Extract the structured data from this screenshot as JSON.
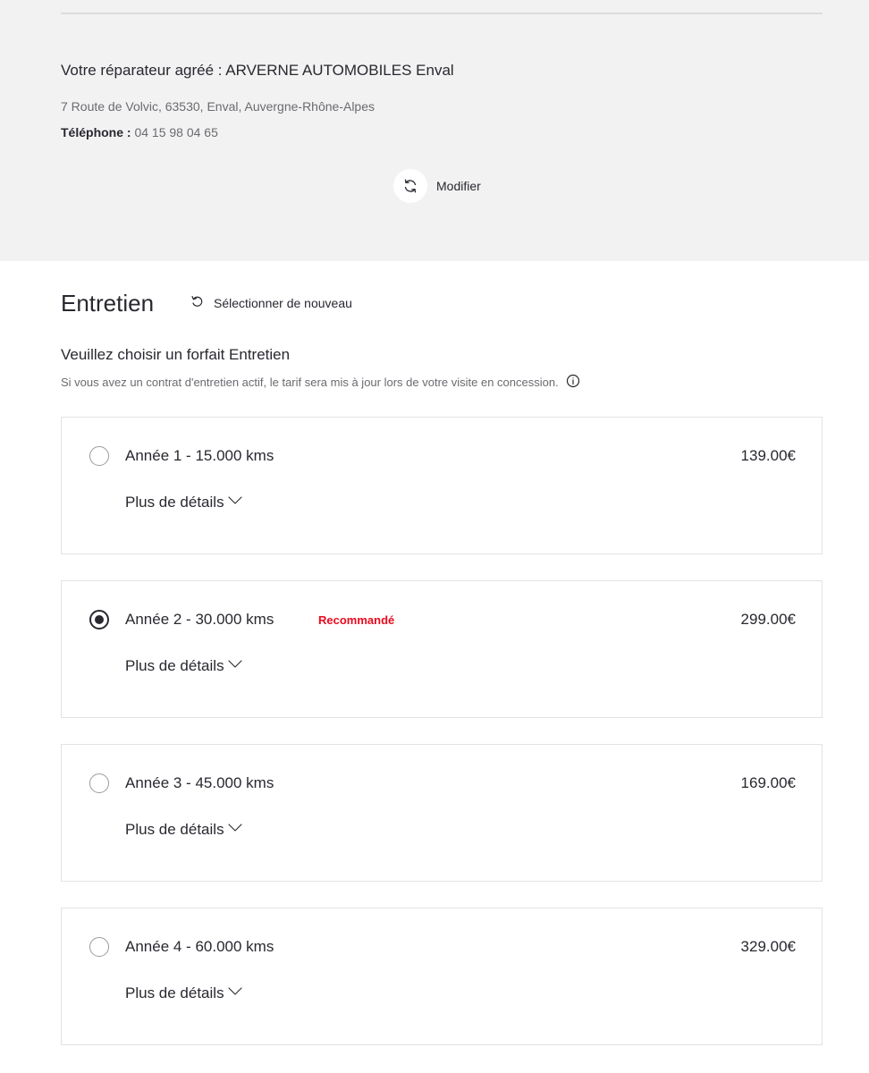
{
  "dealer": {
    "title": "Votre réparateur agréé : ARVERNE AUTOMOBILES Enval",
    "address": "7 Route de Volvic, 63530, Enval, Auvergne-Rhône-Alpes",
    "phone_label": "Téléphone :",
    "phone_value": " 04 15 98 04 65",
    "modify_label": "Modifier",
    "modify_icon": "refresh-icon"
  },
  "maintenance": {
    "title": "Entretien",
    "reselect_label": "Sélectionner de nouveau",
    "reselect_icon": "undo-icon",
    "choose_heading": "Veuillez choisir un forfait Entretien",
    "choose_note": "Si vous avez un contrat d'entretien actif, le tarif sera mis à jour lors de votre visite en concession.",
    "info_icon": "info-icon"
  },
  "packages": [
    {
      "name": "Année 1 - 15.000 kms",
      "price": "139.00€",
      "details_label": "Plus de détails",
      "selected": false,
      "badge": ""
    },
    {
      "name": "Année 2 - 30.000 kms",
      "price": "299.00€",
      "details_label": "Plus de détails",
      "selected": true,
      "badge": "Recommandé"
    },
    {
      "name": "Année 3 - 45.000 kms",
      "price": "169.00€",
      "details_label": "Plus de détails",
      "selected": false,
      "badge": ""
    },
    {
      "name": "Année 4 - 60.000 kms",
      "price": "329.00€",
      "details_label": "Plus de détails",
      "selected": false,
      "badge": ""
    }
  ],
  "colors": {
    "panel_background": "#f2f2f2",
    "text": "#282830",
    "muted_text": "#6a6b70",
    "accent_red": "#eb0a1e",
    "card_border": "#e2e2e4"
  }
}
